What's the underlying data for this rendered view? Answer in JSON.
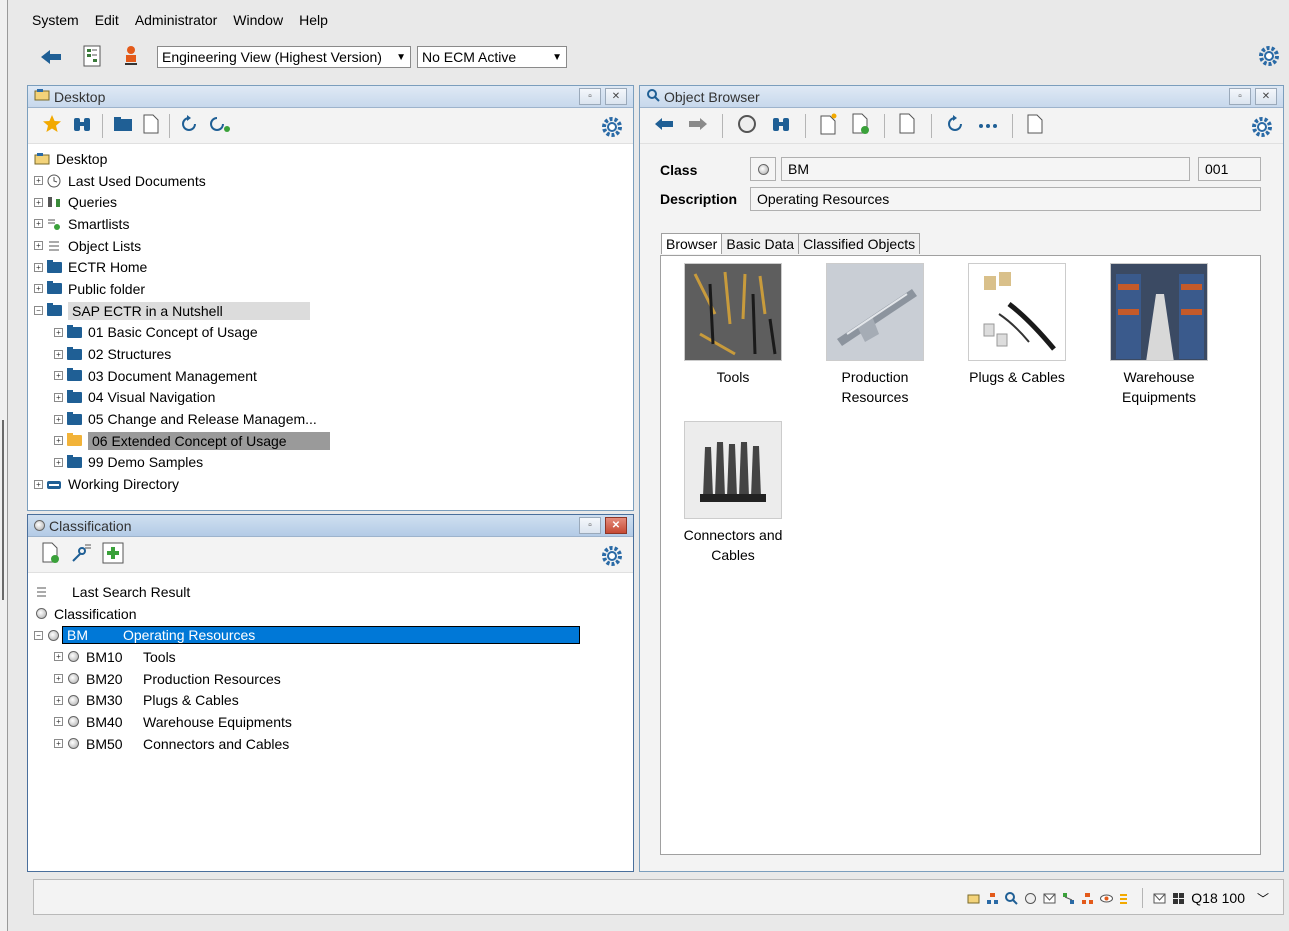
{
  "menu": [
    "System",
    "Edit",
    "Administrator",
    "Window",
    "Help"
  ],
  "main_toolbar": {
    "view_select": "Engineering View (Highest Version)",
    "ecm_select": "No ECM Active"
  },
  "desktop_panel": {
    "title": "Desktop",
    "tree": [
      {
        "label": "Desktop",
        "level": 0,
        "icon": "desktop-icon"
      },
      {
        "label": "Last Used Documents",
        "level": 1,
        "icon": "clock-icon"
      },
      {
        "label": "Queries",
        "level": 1,
        "icon": "binoculars-icon"
      },
      {
        "label": "Smartlists",
        "level": 1,
        "icon": "smartlist-icon"
      },
      {
        "label": "Object Lists",
        "level": 1,
        "icon": "list-icon"
      },
      {
        "label": "ECTR Home",
        "level": 1,
        "icon": "folder-icon"
      },
      {
        "label": "Public folder",
        "level": 1,
        "icon": "folder-icon"
      },
      {
        "label": "SAP ECTR in a Nutshell",
        "level": 1,
        "icon": "folder-icon",
        "state": "expanded-selected"
      },
      {
        "label": "01 Basic Concept of Usage",
        "level": 2,
        "icon": "folder-icon"
      },
      {
        "label": "02 Structures",
        "level": 2,
        "icon": "folder-icon"
      },
      {
        "label": "03 Document Management",
        "level": 2,
        "icon": "folder-icon"
      },
      {
        "label": "04 Visual Navigation",
        "level": 2,
        "icon": "folder-icon"
      },
      {
        "label": "05 Change and Release Managem...",
        "level": 2,
        "icon": "folder-icon"
      },
      {
        "label": "06 Extended Concept of Usage",
        "level": 2,
        "icon": "folder-open-icon",
        "state": "active"
      },
      {
        "label": "99 Demo Samples",
        "level": 2,
        "icon": "folder-icon"
      },
      {
        "label": "Working Directory",
        "level": 1,
        "icon": "drive-icon"
      }
    ]
  },
  "classification_panel": {
    "title": "Classification",
    "last_search": "Last Search Result",
    "root": "Classification",
    "selected": {
      "code": "BM",
      "name": "Operating Resources"
    },
    "children": [
      {
        "code": "BM10",
        "name": "Tools"
      },
      {
        "code": "BM20",
        "name": "Production Resources"
      },
      {
        "code": "BM30",
        "name": "Plugs & Cables"
      },
      {
        "code": "BM40",
        "name": "Warehouse Equipments"
      },
      {
        "code": "BM50",
        "name": "Connectors and Cables"
      }
    ]
  },
  "object_browser": {
    "title": "Object Browser",
    "class_label": "Class",
    "class_value": "BM",
    "class_number": "001",
    "description_label": "Description",
    "description_value": "Operating Resources",
    "tabs": [
      "Browser",
      "Basic Data",
      "Classified Objects"
    ],
    "items": [
      {
        "line1": "Tools",
        "line2": "",
        "colors": [
          "#6b6b6b",
          "#c89b3c",
          "#2c2c2c"
        ]
      },
      {
        "line1": "Production",
        "line2": "Resources",
        "colors": [
          "#b8bfc8",
          "#8c949e",
          "#e3e6ea"
        ]
      },
      {
        "line1": "Plugs & Cables",
        "line2": "",
        "colors": [
          "#ffffff",
          "#d9c08a",
          "#1a1a1a"
        ]
      },
      {
        "line1": "Warehouse",
        "line2": "Equipments",
        "colors": [
          "#3a5a8c",
          "#c45a2a",
          "#d8d8d8"
        ]
      },
      {
        "line1": "Connectors and",
        "line2": "Cables",
        "colors": [
          "#ececec",
          "#555555",
          "#222222"
        ]
      }
    ]
  },
  "status_bar": {
    "system": "Q18 100"
  }
}
